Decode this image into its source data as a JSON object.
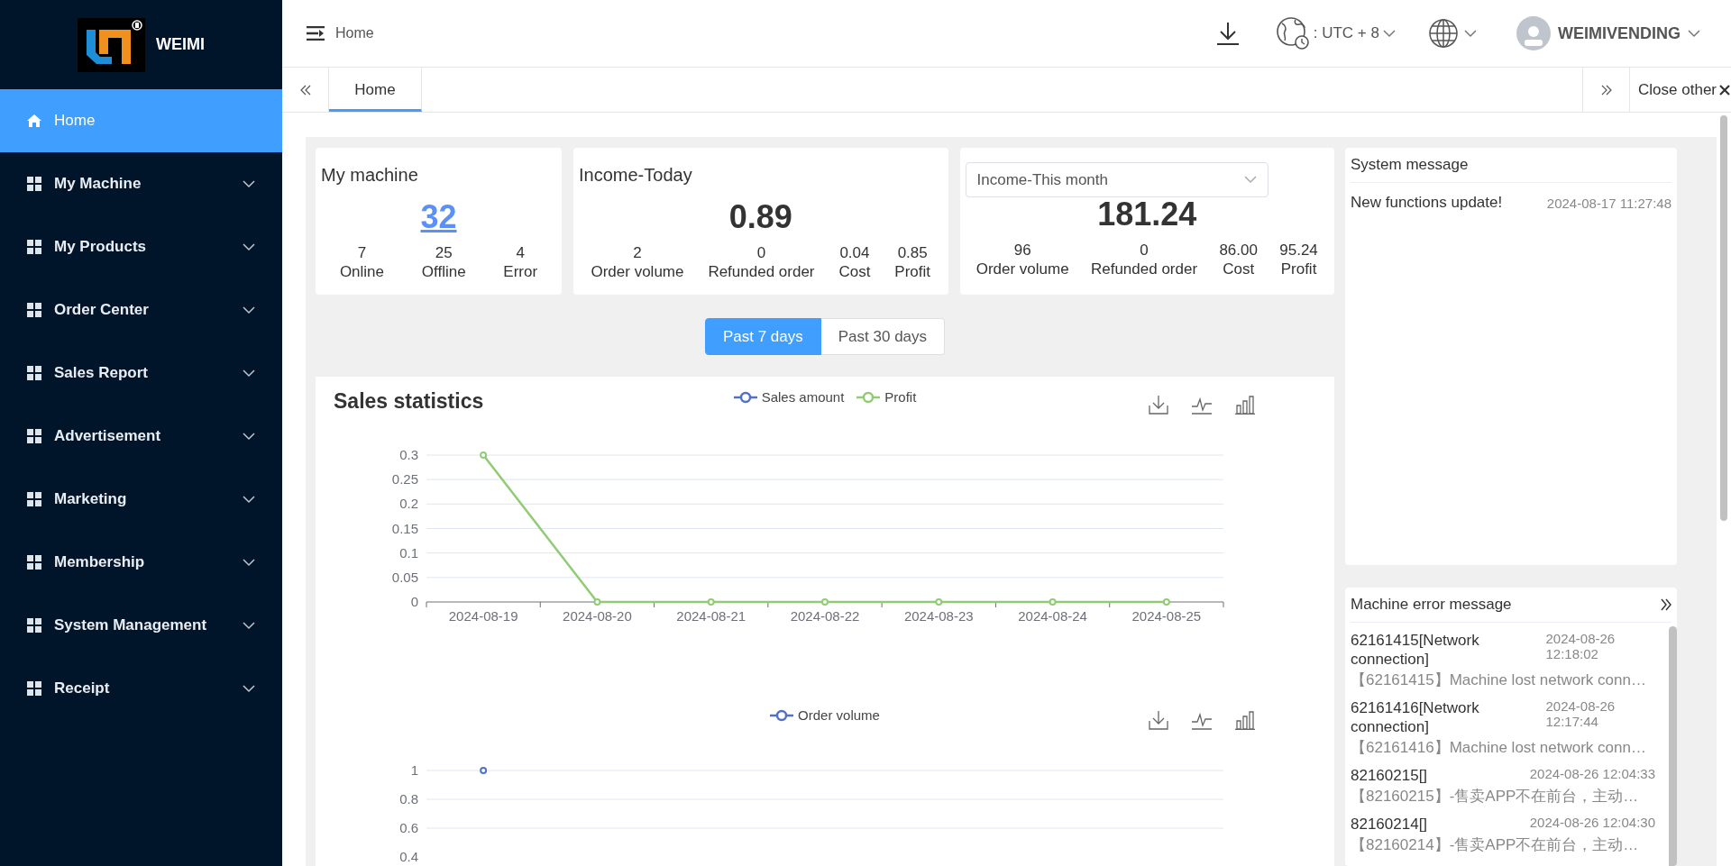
{
  "sidebar": {
    "brand": "WEIMI",
    "items": [
      {
        "label": "Home",
        "kind": "link",
        "selected": true
      },
      {
        "label": "My Machine",
        "kind": "menu",
        "selected": false
      },
      {
        "label": "My Products",
        "kind": "menu",
        "selected": false
      },
      {
        "label": "Order Center",
        "kind": "menu",
        "selected": false
      },
      {
        "label": "Sales Report",
        "kind": "menu",
        "selected": false
      },
      {
        "label": "Advertisement",
        "kind": "menu",
        "selected": false
      },
      {
        "label": "Marketing",
        "kind": "menu",
        "selected": false
      },
      {
        "label": "Membership",
        "kind": "menu",
        "selected": false
      },
      {
        "label": "System Management",
        "kind": "menu",
        "selected": false
      },
      {
        "label": "Receipt",
        "kind": "menu",
        "selected": false
      }
    ]
  },
  "header": {
    "breadcrumb": "Home",
    "timezone": ": UTC + 8",
    "user": "WEIMIVENDING"
  },
  "tabs": [
    {
      "label": "Home",
      "selected": true
    }
  ],
  "close_others": "Close other",
  "cards": [
    {
      "kind": "count",
      "title": "My machine",
      "value": "32",
      "stats": [
        {
          "value": "7",
          "label": "Online"
        },
        {
          "value": "25",
          "label": "Offline"
        },
        {
          "value": "4",
          "label": "Error"
        }
      ]
    },
    {
      "kind": "income",
      "title": "Income-Today",
      "value": "0.89",
      "stats": [
        {
          "value": "2",
          "label": "Order volume"
        },
        {
          "value": "0",
          "label": "Refunded order"
        },
        {
          "value": "0.04",
          "label": "Cost"
        },
        {
          "value": "0.85",
          "label": "Profit"
        }
      ]
    },
    {
      "kind": "income_select",
      "select": "Income-This month",
      "value": "181.24",
      "stats": [
        {
          "value": "96",
          "label": "Order volume"
        },
        {
          "value": "0",
          "label": "Refunded order"
        },
        {
          "value": "86.00",
          "label": "Cost"
        },
        {
          "value": "95.24",
          "label": "Profit"
        }
      ]
    }
  ],
  "range_toggle": [
    {
      "label": "Past 7 days",
      "selected": true
    },
    {
      "label": "Past 30 days",
      "selected": false
    }
  ],
  "sales_panel": {
    "title": "Sales statistics",
    "charts": [
      {
        "chart_data": {
          "type": "line",
          "categories": [
            "2024-08-19",
            "2024-08-20",
            "2024-08-21",
            "2024-08-22",
            "2024-08-23",
            "2024-08-24",
            "2024-08-25"
          ],
          "series": [
            {
              "name": "Sales amount",
              "color": "#5470c6",
              "marker": true,
              "values": [
                null,
                null,
                null,
                null,
                null,
                null,
                null
              ]
            },
            {
              "name": "Profit",
              "color": "#91cc75",
              "marker": true,
              "values": [
                0.3,
                0,
                0,
                0,
                0,
                0,
                0
              ]
            }
          ],
          "ylim": [
            0,
            0.3
          ],
          "yticks": [
            0,
            0.05,
            0.1,
            0.15,
            0.2,
            0.25,
            0.3
          ],
          "grid": true
        }
      },
      {
        "chart_data": {
          "type": "line",
          "series": [
            {
              "name": "Order volume",
              "color": "#5470c6",
              "marker": true,
              "values": [
                1,
                null,
                null,
                null,
                null,
                null,
                null
              ]
            }
          ],
          "ylim": [
            0.4,
            1
          ],
          "yticks": [
            0.4,
            0.6,
            0.8,
            1
          ],
          "grid": true
        }
      }
    ]
  },
  "system_message": {
    "title": "System message",
    "items": [
      {
        "text": "New functions update!",
        "time": "2024-08-17 11:27:48"
      }
    ]
  },
  "machine_errors": {
    "title": "Machine error message",
    "items": [
      {
        "title": "62161415[Network connection]",
        "time": "2024-08-26 12:18:02",
        "detail": "【62161415】Machine lost network conn…"
      },
      {
        "title": "62161416[Network connection]",
        "time": "2024-08-26 12:17:44",
        "detail": "【62161416】Machine lost network conn…"
      },
      {
        "title": "82160215[]",
        "time": "2024-08-26 12:04:33",
        "detail": "【82160215】-售卖APP不在前台，主动…"
      },
      {
        "title": "82160214[]",
        "time": "2024-08-26 12:04:30",
        "detail": "【82160214】-售卖APP不在前台，主动…"
      }
    ]
  }
}
